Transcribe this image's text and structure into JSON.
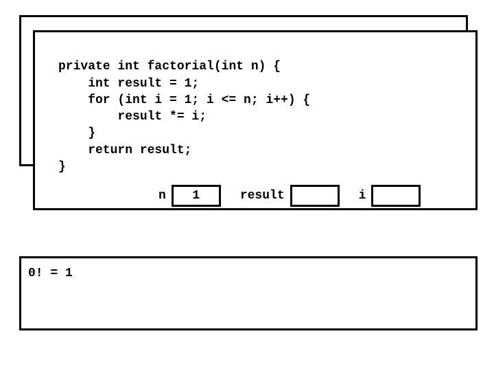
{
  "code": {
    "line1": "private int factorial(int n) {",
    "line2": "    int result = 1;",
    "line3": "    for (int i = 1; i <= n; i++) {",
    "line4": "        result *= i;",
    "line5": "    }",
    "line6": "    return result;",
    "line7": "}"
  },
  "vars": {
    "n_label": "n",
    "n_value": "1",
    "result_label": "result",
    "result_value": "",
    "i_label": "i",
    "i_value": ""
  },
  "output": {
    "line1": "0! = 1"
  }
}
